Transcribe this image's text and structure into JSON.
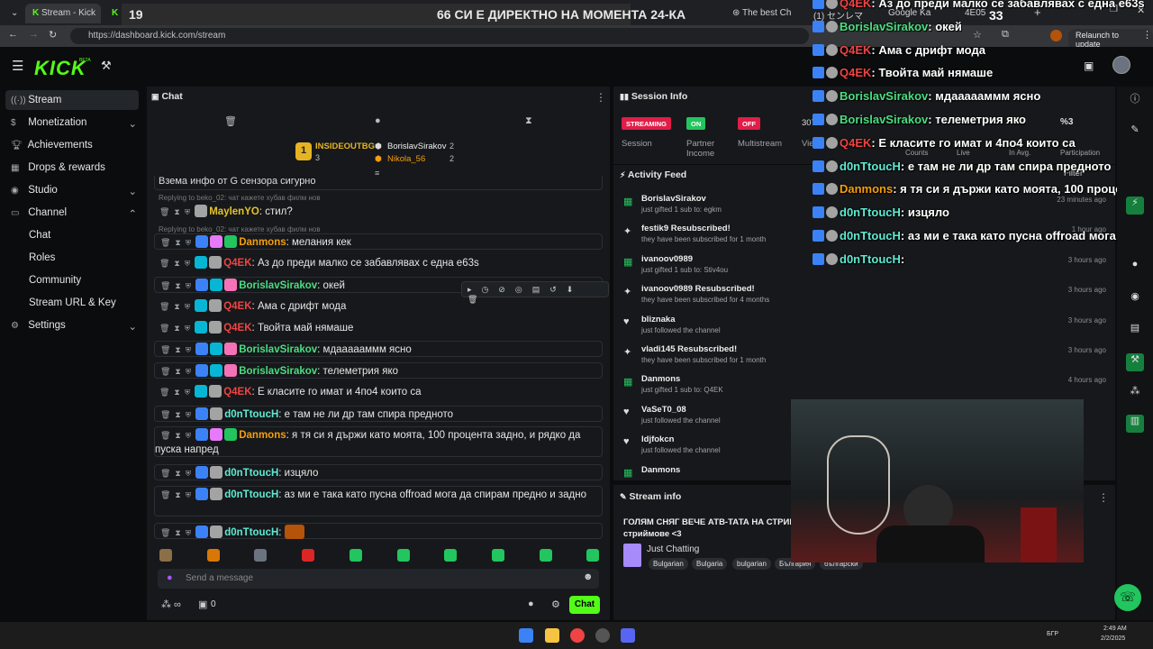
{
  "browser": {
    "tabs": [
      "Stream - Kick",
      "The best Ch",
      "(1) センレマ",
      "Google Ka",
      "4E05"
    ],
    "url": "https://dashboard.kick.com/stream",
    "relaunch": "Relaunch to update"
  },
  "banner": {
    "count": "19",
    "text": "66 СИ Е ДИРЕКТНО НА МОМЕНТА 24-КА"
  },
  "header": {
    "logo": "KICK",
    "beta": "BETA"
  },
  "sidebar": {
    "items": [
      {
        "label": "Stream",
        "icon": "stream-icon"
      },
      {
        "label": "Monetization",
        "icon": "dollar-icon"
      },
      {
        "label": "Achievements",
        "icon": "trophy-icon"
      },
      {
        "label": "Drops & rewards",
        "icon": "gift-icon"
      },
      {
        "label": "Studio",
        "icon": "studio-icon"
      },
      {
        "label": "Channel",
        "icon": "channel-icon"
      },
      {
        "label": "Chat"
      },
      {
        "label": "Roles"
      },
      {
        "label": "Community"
      },
      {
        "label": "Stream URL & Key"
      },
      {
        "label": "Settings",
        "icon": "gear-icon"
      }
    ]
  },
  "chat": {
    "title": "Chat",
    "top_gifters": [
      {
        "name": "INSIDEOUTBG",
        "count": "3"
      },
      {
        "name": "BorislavSirakov",
        "count": "2"
      },
      {
        "name": "Nikola_56",
        "count": "2"
      }
    ],
    "cut_message": "Взема инфо от G сензора сигурно",
    "reply1": "Replying to beko_02: чат кажете хубав филм нов",
    "reply2": "Replying to beko_02: чат кажете хубав филм нов",
    "messages": [
      {
        "user": "MaylenYO",
        "color": "#e6c229",
        "text": "стил?"
      },
      {
        "user": "Danmons",
        "color": "#f59e0b",
        "text": "мелания кек"
      },
      {
        "user": "Q4EK",
        "color": "#ef4444",
        "text": "Аз до преди малко се забавлявах с една e63s"
      },
      {
        "user": "BorislavSirakov",
        "color": "#4ade80",
        "text": "окей"
      },
      {
        "user": "Q4EK",
        "color": "#ef4444",
        "text": "Ама с дрифт мода"
      },
      {
        "user": "Q4EK",
        "color": "#ef4444",
        "text": "Твойта май нямаше"
      },
      {
        "user": "BorislavSirakov",
        "color": "#4ade80",
        "text": "мдаааааммм ясно"
      },
      {
        "user": "BorislavSirakov",
        "color": "#4ade80",
        "text": "телеметрия яко"
      },
      {
        "user": "Q4EK",
        "color": "#ef4444",
        "text": "Е класите го имат и 4по4 които са"
      },
      {
        "user": "d0nTtoucH",
        "color": "#5eead4",
        "text": "е там не ли др там спира предното"
      },
      {
        "user": "Danmons",
        "color": "#f59e0b",
        "text": "я тя си я държи като моята, 100 процента задно, и рядко да пуска напред"
      },
      {
        "user": "d0nTtoucH",
        "color": "#5eead4",
        "text": "изцяло"
      },
      {
        "user": "d0nTtoucH",
        "color": "#5eead4",
        "text": "аз ми е така като пусна offroad мога да спирам предно и задно"
      },
      {
        "user": "d0nTtoucH",
        "color": "#5eead4",
        "text": ""
      }
    ],
    "input_placeholder": "Send a message",
    "viewers_count": "0",
    "chat_button": "Chat"
  },
  "session": {
    "title": "Session Info",
    "pills": [
      {
        "text": "STREAMING",
        "label": "Session",
        "color": "#e11d48"
      },
      {
        "text": "ON",
        "label": "Partner Income",
        "color": "#22c55e"
      },
      {
        "text": "OFF",
        "label": "Multistream",
        "color": "#e11d48"
      }
    ],
    "partial_count": "307",
    "partial_label": "Vie"
  },
  "activity": {
    "title": "Activity Feed",
    "filter": "Filter",
    "items": [
      {
        "name": "BorislavSirakov",
        "desc": "just gifted 1 sub to: egkm",
        "time": "23 minutes ago",
        "icon": "gift"
      },
      {
        "name": "festik9 Resubscribed!",
        "desc": "they have been subscribed for 1 month",
        "time": "1 hour ago",
        "icon": "star"
      },
      {
        "name": "ivanoov0989",
        "desc": "just gifted 1 sub to: Stiv4ou",
        "time": "3 hours ago",
        "icon": "gift"
      },
      {
        "name": "ivanoov0989 Resubscribed!",
        "desc": "they have been subscribed for 4 months",
        "time": "3 hours ago",
        "icon": "star"
      },
      {
        "name": "bliznaka",
        "desc": "just followed the channel",
        "time": "3 hours ago",
        "icon": "heart"
      },
      {
        "name": "vladi145 Resubscribed!",
        "desc": "they have been subscribed for 1 month",
        "time": "3 hours ago",
        "icon": "star"
      },
      {
        "name": "Danmons",
        "desc": "just gifted 1 sub to: Q4EK",
        "time": "4 hours ago",
        "icon": "gift"
      },
      {
        "name": "VaSeT0_08",
        "desc": "just followed the channel",
        "time": "",
        "icon": "heart"
      },
      {
        "name": "ldjfokcn",
        "desc": "just followed the channel",
        "time": "",
        "icon": "heart"
      },
      {
        "name": "Danmons",
        "desc": "",
        "time": "",
        "icon": "gift"
      }
    ]
  },
  "stream_info": {
    "title": "Stream info",
    "stream_title": "ГОЛЯМ СНЯГ ВЕЧЕ АТВ-ТАТА НА СТРИЙМ",
    "stream_title2": "стриймове <3",
    "category": "Just Chatting",
    "tags": [
      "Bulgarian",
      "Bulgaria",
      "bulgarian",
      "България",
      "български"
    ]
  },
  "overlay": {
    "top_count": "33",
    "lines": [
      {
        "user": "Q4EK",
        "color": "#ef4444",
        "text": ": Аз до преди малко се забавлявах с една e63s"
      },
      {
        "user": "BorislavSirakov",
        "color": "#4ade80",
        "text": ": окей"
      },
      {
        "user": "Q4EK",
        "color": "#ef4444",
        "text": ": Ама с дрифт мода"
      },
      {
        "user": "Q4EK",
        "color": "#ef4444",
        "text": ": Твойта май нямаше"
      },
      {
        "user": "BorislavSirakov",
        "color": "#4ade80",
        "text": ": мдаааааммм ясно"
      },
      {
        "user": "BorislavSirakov",
        "color": "#4ade80",
        "text": ": телеметрия яко"
      },
      {
        "user": "Q4EK",
        "color": "#ef4444",
        "text": ": Е класите го имат и 4по4 които са"
      },
      {
        "user": "d0nTtoucH",
        "color": "#5eead4",
        "text": ": е там не ли др там спира предното"
      },
      {
        "user": "Danmons",
        "color": "#f59e0b",
        "text": ": я тя си я държи като моята, 100 проце"
      },
      {
        "user": "d0nTtoucH",
        "color": "#5eead4",
        "text": ": изцяло"
      },
      {
        "user": "d0nTtoucH",
        "color": "#5eead4",
        "text": ": аз ми е така като пусна offroad мога да"
      },
      {
        "user": "d0nTtoucH",
        "color": "#5eead4",
        "text": ":"
      }
    ],
    "stat_labels": [
      "Counts",
      "Live",
      "In Avg.",
      "Participation"
    ],
    "stat_value": "%3"
  },
  "taskbar": {
    "lang": "БГР",
    "time": "2:49 AM",
    "date": "2/2/2025"
  }
}
